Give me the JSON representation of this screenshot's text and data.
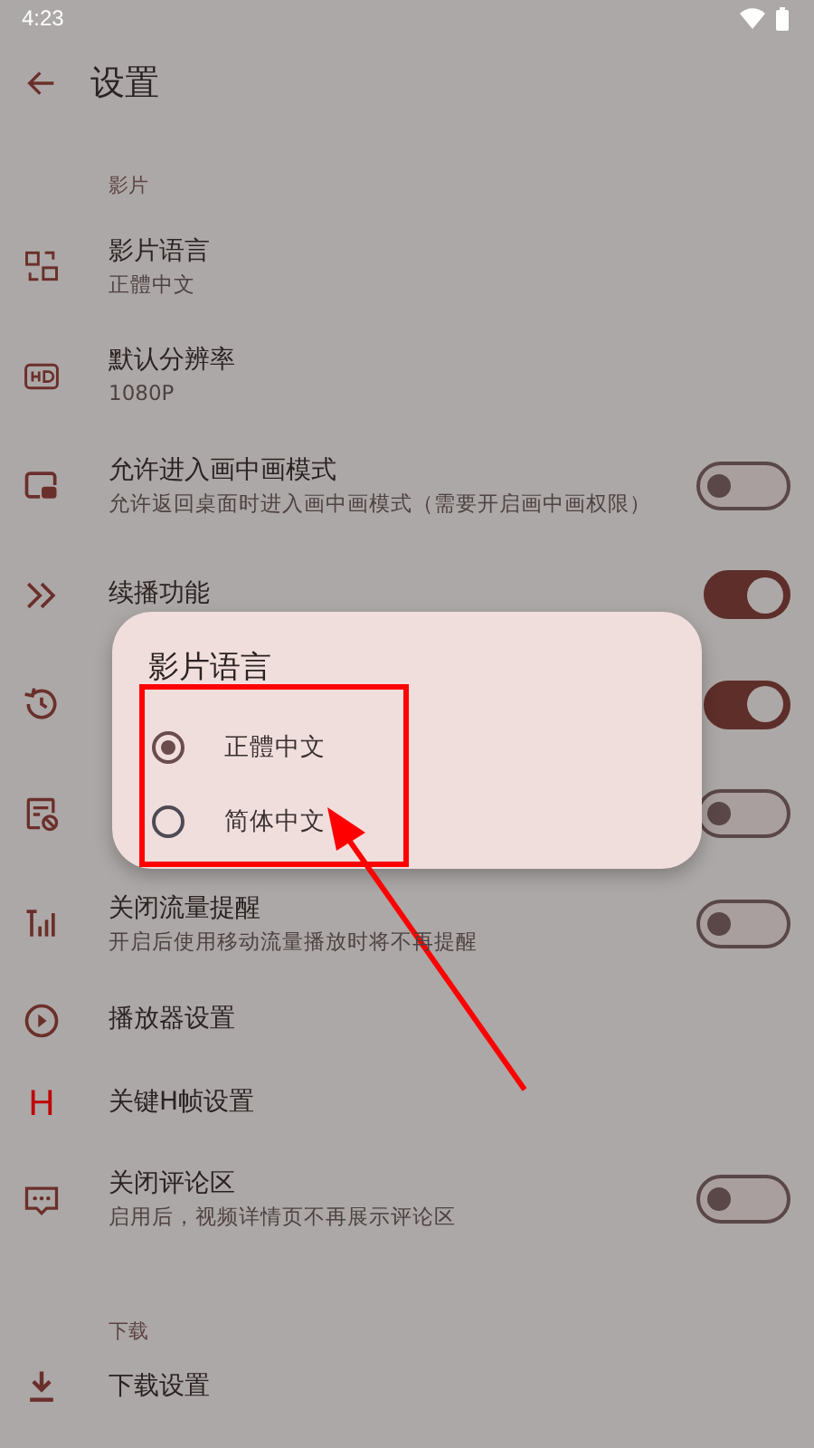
{
  "status_bar": {
    "time": "4:23"
  },
  "app_bar": {
    "title": "设置"
  },
  "rows": [
    {
      "kind": "section",
      "title": "影片"
    },
    {
      "kind": "nav",
      "title": "影片语言",
      "subtitle": "正體中文"
    },
    {
      "kind": "nav",
      "title": "默认分辨率",
      "subtitle": "1080P"
    },
    {
      "kind": "switch",
      "title": "允许进入画中画模式",
      "subtitle": "允许返回桌面时进入画中画模式（需要开启画中画权限）",
      "on": false
    },
    {
      "kind": "switch",
      "title": "续播功能",
      "on": true
    },
    {
      "kind": "switch",
      "on": true
    },
    {
      "kind": "switch",
      "on": false
    },
    {
      "kind": "switch",
      "title": "关闭流量提醒",
      "subtitle": "开启后使用移动流量播放时将不再提醒",
      "on": false
    },
    {
      "kind": "nav",
      "title": "播放器设置"
    },
    {
      "kind": "nav",
      "title": "关键H帧设置",
      "icon_text": "H"
    },
    {
      "kind": "switch",
      "title": "关闭评论区",
      "subtitle": "启用后，视频详情页不再展示评论区",
      "on": false
    },
    {
      "kind": "section",
      "title": "下载"
    },
    {
      "kind": "nav",
      "title": "下载设置"
    }
  ],
  "dialog": {
    "title": "影片语言",
    "options": [
      {
        "label": "正體中文",
        "selected": true
      },
      {
        "label": "简体中文",
        "selected": false
      }
    ]
  }
}
